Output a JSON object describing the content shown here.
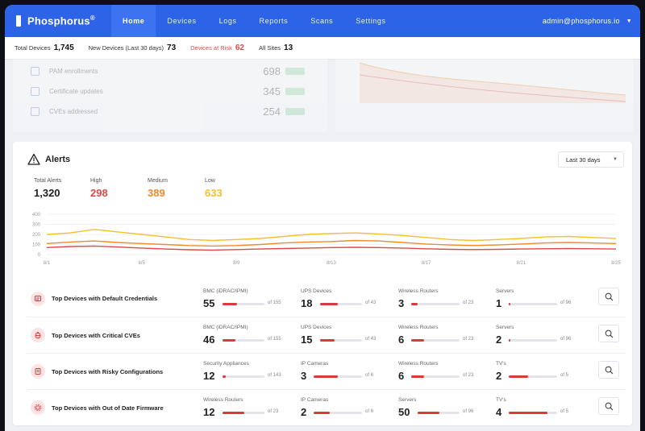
{
  "app": {
    "name": "Phosphorus",
    "name_mark": "®"
  },
  "nav": {
    "items": [
      {
        "label": "Home",
        "active": true
      },
      {
        "label": "Devices",
        "active": false
      },
      {
        "label": "Logs",
        "active": false
      },
      {
        "label": "Reports",
        "active": false
      },
      {
        "label": "Scans",
        "active": false
      },
      {
        "label": "Settings",
        "active": false
      }
    ],
    "account": "admin@phosphorus.io"
  },
  "stats": {
    "total_devices_label": "Total Devices",
    "total_devices": "1,745",
    "new_devices_label": "New Devices (Last 30 days)",
    "new_devices": "73",
    "at_risk_label": "Devices at Risk",
    "at_risk": "62",
    "all_sites_label": "All Sites",
    "all_sites": "13"
  },
  "background_card": {
    "rows": [
      {
        "label": "PAM enrollments",
        "value": "698"
      },
      {
        "label": "Certificate updates",
        "value": "345"
      },
      {
        "label": "CVEs addressed",
        "value": "254"
      }
    ]
  },
  "alerts": {
    "title": "Alerts",
    "range": "Last 30 days",
    "summary": {
      "total_label": "Total Alerts",
      "total": "1,320",
      "high_label": "High",
      "high": "298",
      "medium_label": "Medium",
      "medium": "389",
      "low_label": "Low",
      "low": "633"
    },
    "colors": {
      "high": "#e04848",
      "medium": "#f08a2a",
      "low": "#f5c02a"
    }
  },
  "chart_data": {
    "type": "line",
    "x": [
      "8/1",
      "8/2",
      "8/3",
      "8/4",
      "8/5",
      "8/6",
      "8/7",
      "8/8",
      "8/9",
      "8/10",
      "8/11",
      "8/12",
      "8/13",
      "8/14",
      "8/15",
      "8/16",
      "8/17",
      "8/18",
      "8/19",
      "8/20",
      "8/21",
      "8/22",
      "8/23",
      "8/24",
      "8/25"
    ],
    "xticks": [
      "8/1",
      "8/5",
      "8/9",
      "8/13",
      "8/17",
      "8/21",
      "8/25"
    ],
    "yticks": [
      "0",
      "100",
      "200",
      "300",
      "400"
    ],
    "ylim": [
      0,
      400
    ],
    "series": [
      {
        "color": "#f5c02a",
        "values": [
          200,
          215,
          250,
          225,
          200,
          175,
          150,
          140,
          150,
          160,
          180,
          200,
          210,
          215,
          205,
          190,
          170,
          150,
          140,
          150,
          160,
          175,
          180,
          170,
          160
        ]
      },
      {
        "color": "#f08a2a",
        "values": [
          110,
          125,
          135,
          120,
          110,
          100,
          90,
          85,
          90,
          100,
          115,
          125,
          130,
          140,
          135,
          120,
          105,
          95,
          90,
          95,
          105,
          115,
          120,
          115,
          110
        ]
      },
      {
        "color": "#e04848",
        "values": [
          70,
          80,
          85,
          75,
          65,
          55,
          48,
          45,
          50,
          55,
          60,
          65,
          70,
          72,
          70,
          65,
          58,
          52,
          50,
          52,
          55,
          58,
          60,
          58,
          55
        ]
      }
    ]
  },
  "device_rows": [
    {
      "title": "Top Devices with Default Credentials",
      "icon": "key-icon",
      "metrics": [
        {
          "cat": "BMC (iDRAC/IPMI)",
          "count": "55",
          "of": "of 155",
          "fraction": 0.35
        },
        {
          "cat": "UPS Devices",
          "count": "18",
          "of": "of 43",
          "fraction": 0.42
        },
        {
          "cat": "Wireless Routers",
          "count": "3",
          "of": "of 23",
          "fraction": 0.13
        },
        {
          "cat": "Servers",
          "count": "1",
          "of": "of 96",
          "fraction": 0.01
        }
      ]
    },
    {
      "title": "Top Devices with Critical CVEs",
      "icon": "bug-icon",
      "metrics": [
        {
          "cat": "BMC (iDRAC/IPMI)",
          "count": "46",
          "of": "of 155",
          "fraction": 0.3
        },
        {
          "cat": "UPS Devices",
          "count": "15",
          "of": "of 43",
          "fraction": 0.35
        },
        {
          "cat": "Wireless Routers",
          "count": "6",
          "of": "of 23",
          "fraction": 0.26
        },
        {
          "cat": "Servers",
          "count": "2",
          "of": "of 96",
          "fraction": 0.02
        }
      ]
    },
    {
      "title": "Top Devices with Risky Configurations",
      "icon": "config-icon",
      "metrics": [
        {
          "cat": "Security Appliances",
          "count": "12",
          "of": "of 143",
          "fraction": 0.08
        },
        {
          "cat": "IP Cameras",
          "count": "3",
          "of": "of 6",
          "fraction": 0.5
        },
        {
          "cat": "Wireless Routers",
          "count": "6",
          "of": "of 23",
          "fraction": 0.26
        },
        {
          "cat": "TV's",
          "count": "2",
          "of": "of 5",
          "fraction": 0.4
        }
      ]
    },
    {
      "title": "Top Devices with Out of Date Firmware",
      "icon": "firmware-icon",
      "metrics": [
        {
          "cat": "Wireless Routers",
          "count": "12",
          "of": "of 23",
          "fraction": 0.52
        },
        {
          "cat": "IP Cameras",
          "count": "2",
          "of": "of 6",
          "fraction": 0.33
        },
        {
          "cat": "Servers",
          "count": "50",
          "of": "of 96",
          "fraction": 0.52
        },
        {
          "cat": "TV's",
          "count": "4",
          "of": "of 5",
          "fraction": 0.8
        }
      ]
    }
  ]
}
